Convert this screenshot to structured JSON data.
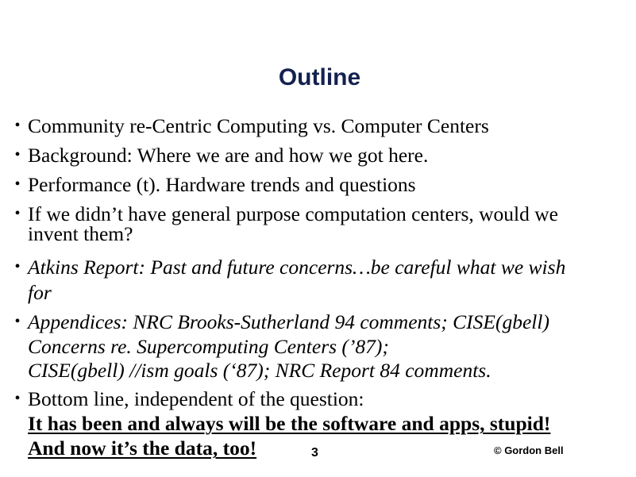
{
  "slide": {
    "title": "Outline",
    "bullet_glyph": "•",
    "items": [
      {
        "lines": [
          "Community re-Centric Computing vs. Computer Centers"
        ]
      },
      {
        "lines": [
          "Background: Where we are and how we got here."
        ]
      },
      {
        "lines": [
          "Performance (t). Hardware trends and questions"
        ]
      },
      {
        "lines": [
          "If we didn’t have general purpose computation centers, would we",
          "invent them?"
        ]
      },
      {
        "lines": [
          "Atkins Report: Past and future concerns…be careful what we wish",
          "for"
        ]
      },
      {
        "lines": [
          "Appendices: NRC Brooks-Sutherland 94 comments; CISE(gbell)",
          "Concerns re. Supercomputing Centers (’87);",
          "CISE(gbell) //ism goals (‘87); NRC Report 84 comments."
        ]
      },
      {
        "lines": [
          "Bottom line, independent of the question:",
          "It has been and always will be the software and apps, stupid!",
          "And now it’s the data, too!"
        ]
      }
    ],
    "page_number": "3",
    "copyright": "© Gordon Bell"
  }
}
